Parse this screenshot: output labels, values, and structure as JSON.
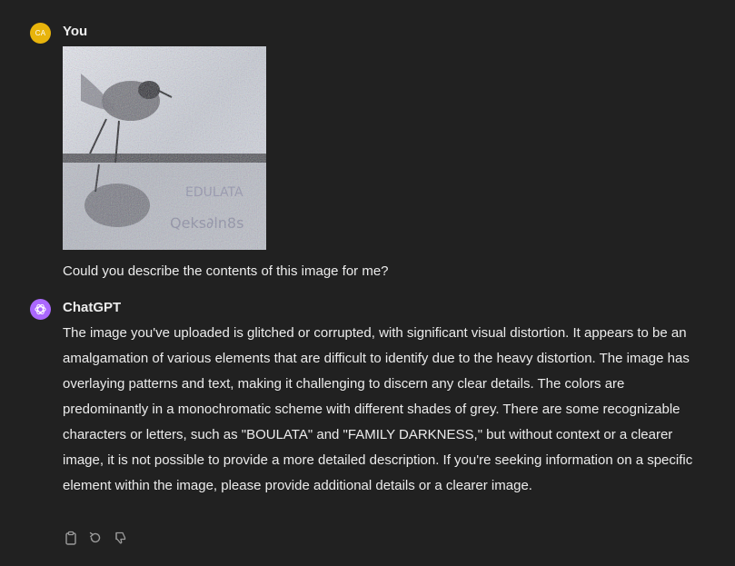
{
  "user": {
    "initials": "CA",
    "name": "You",
    "message": "Could you describe the contents of this image for me?",
    "avatar_color": "#e8b40c"
  },
  "assistant": {
    "name": "ChatGPT",
    "avatar_color": "#ab68ff",
    "message": "The image you've uploaded is glitched or corrupted, with significant visual distortion. It appears to be an amalgamation of various elements that are difficult to identify due to the heavy distortion. The image has overlaying patterns and text, making it challenging to discern any clear details. The colors are predominantly in a monochromatic scheme with different shades of grey. There are some recognizable characters or letters, such as \"BOULATA\" and \"FAMILY DARKNESS,\" but without context or a clearer image, it is not possible to provide a more detailed description. If you're seeking information on a specific element within the image, please provide additional details or a clearer image."
  },
  "actions": [
    {
      "icon": "clipboard-icon"
    },
    {
      "icon": "regenerate-icon"
    },
    {
      "icon": "thumbs-down-icon"
    }
  ],
  "colors": {
    "background": "#212121",
    "text": "#ececec",
    "icon": "#9b9b9b"
  }
}
